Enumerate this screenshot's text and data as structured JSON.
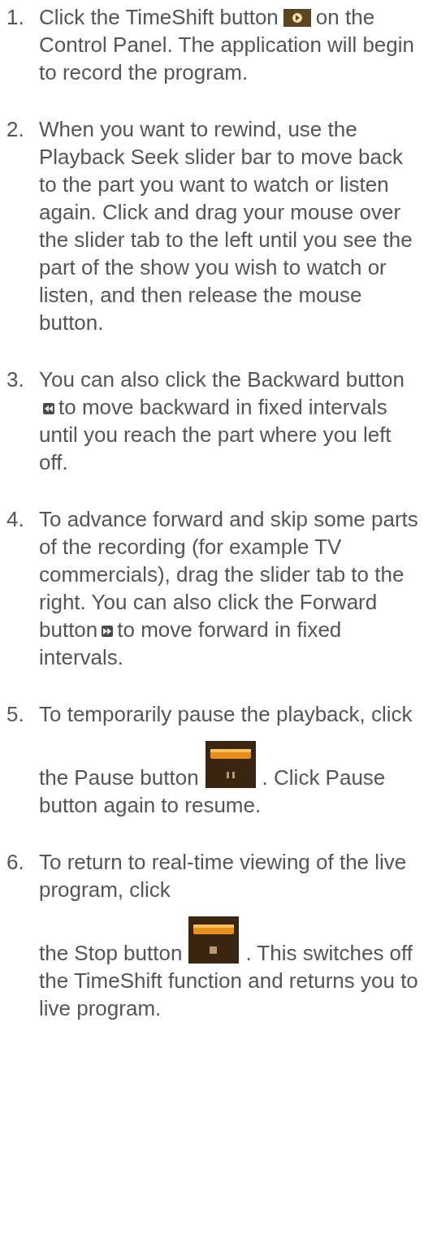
{
  "steps": [
    {
      "number": "1.",
      "paragraphs": [
        [
          {
            "kind": "text",
            "text": "Click the TimeShift button"
          },
          {
            "kind": "timeshift-button"
          },
          {
            "kind": "text",
            "text": "on the Control Panel. The application will begin to record the program."
          }
        ]
      ]
    },
    {
      "number": "2.",
      "paragraphs": [
        [
          {
            "kind": "text",
            "text": "When you want to rewind, use the Playback Seek slider bar to move back to the part you want to watch or listen again. Click and drag your mouse over the slider tab to the left until you see the part of the show you wish to watch or listen, and then release the mouse button."
          }
        ]
      ]
    },
    {
      "number": "3.",
      "paragraphs": [
        [
          {
            "kind": "text",
            "text": "You can also click the Backward button"
          },
          {
            "kind": "backward-button"
          },
          {
            "kind": "text",
            "text": "to move backward in fixed intervals until you reach the part where you left off."
          }
        ]
      ]
    },
    {
      "number": "4.",
      "paragraphs": [
        [
          {
            "kind": "text",
            "text": "To advance forward and skip some parts of the recording (for example TV commercials), drag the slider tab to the right. You can also click the Forward button"
          },
          {
            "kind": "forward-button"
          },
          {
            "kind": "text",
            "text": "to move forward in fixed intervals."
          }
        ]
      ]
    },
    {
      "number": "5.",
      "paragraphs": [
        [
          {
            "kind": "text",
            "text": "To temporarily pause the playback, click"
          }
        ],
        [
          {
            "kind": "text",
            "text": "the Pause button"
          },
          {
            "kind": "pause-button"
          },
          {
            "kind": "text",
            "text": ". Click Pause button again to resume."
          }
        ]
      ]
    },
    {
      "number": "6.",
      "paragraphs": [
        [
          {
            "kind": "text",
            "text": "To return to real-time viewing of the live program, click"
          }
        ],
        [
          {
            "kind": "text",
            "text": "the Stop button"
          },
          {
            "kind": "stop-button"
          },
          {
            "kind": "text",
            "text": ". This switches off the TimeShift function and returns you to live program."
          }
        ]
      ]
    }
  ]
}
